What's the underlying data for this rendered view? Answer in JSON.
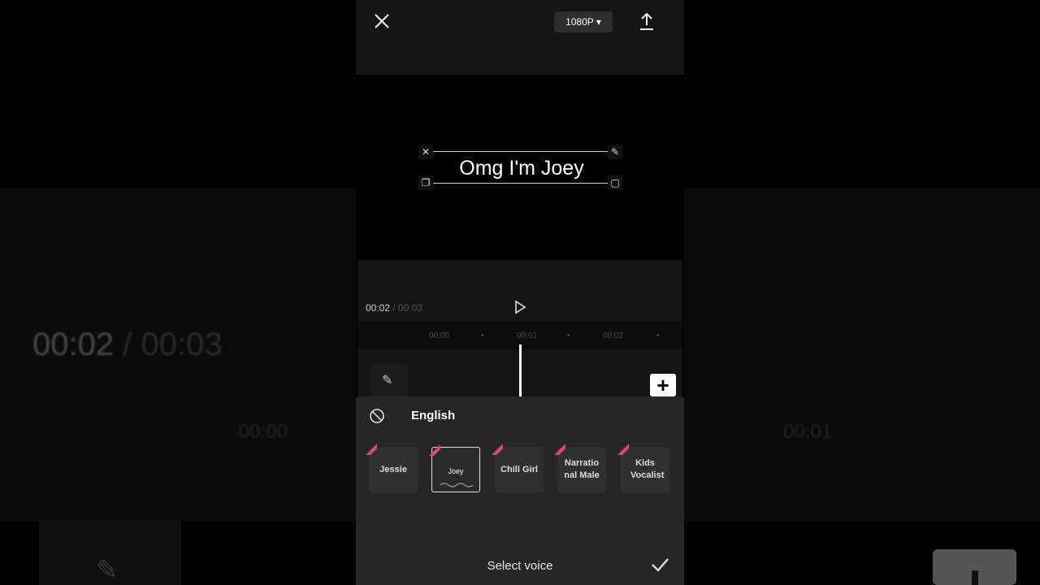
{
  "background": {
    "time_current": "00:02",
    "time_separator": "/",
    "time_total": "00:03",
    "tick_left": "00:00",
    "tick_right": "00:01"
  },
  "topbar": {
    "resolution_label": "1080P ▾"
  },
  "preview": {
    "text_content": "Omg I'm Joey"
  },
  "timeline": {
    "time_current": "00:02",
    "time_separator": " / ",
    "time_total": "00:03",
    "ruler_ticks": [
      "00:00",
      "•",
      "00:01",
      "•",
      "00:02",
      "•"
    ]
  },
  "voice_sheet": {
    "language_label": "English",
    "voices": [
      {
        "name": "Jessie",
        "selected": false
      },
      {
        "name": "Joey",
        "selected": true
      },
      {
        "name": "Chill Girl",
        "selected": false
      },
      {
        "name": "Narratio nal Male",
        "selected": false
      },
      {
        "name": "Kids Vocalist",
        "selected": false
      }
    ],
    "title": "Select voice"
  },
  "colors": {
    "background": "#000000",
    "sheet": "#262626",
    "badge": "#e0457a",
    "text": "#ffffff"
  },
  "icons": [
    "close-icon",
    "export-icon",
    "play-icon",
    "edit-icon",
    "plus-icon",
    "no-effect-icon",
    "checkmark-icon",
    "pro-badge-icon"
  ]
}
